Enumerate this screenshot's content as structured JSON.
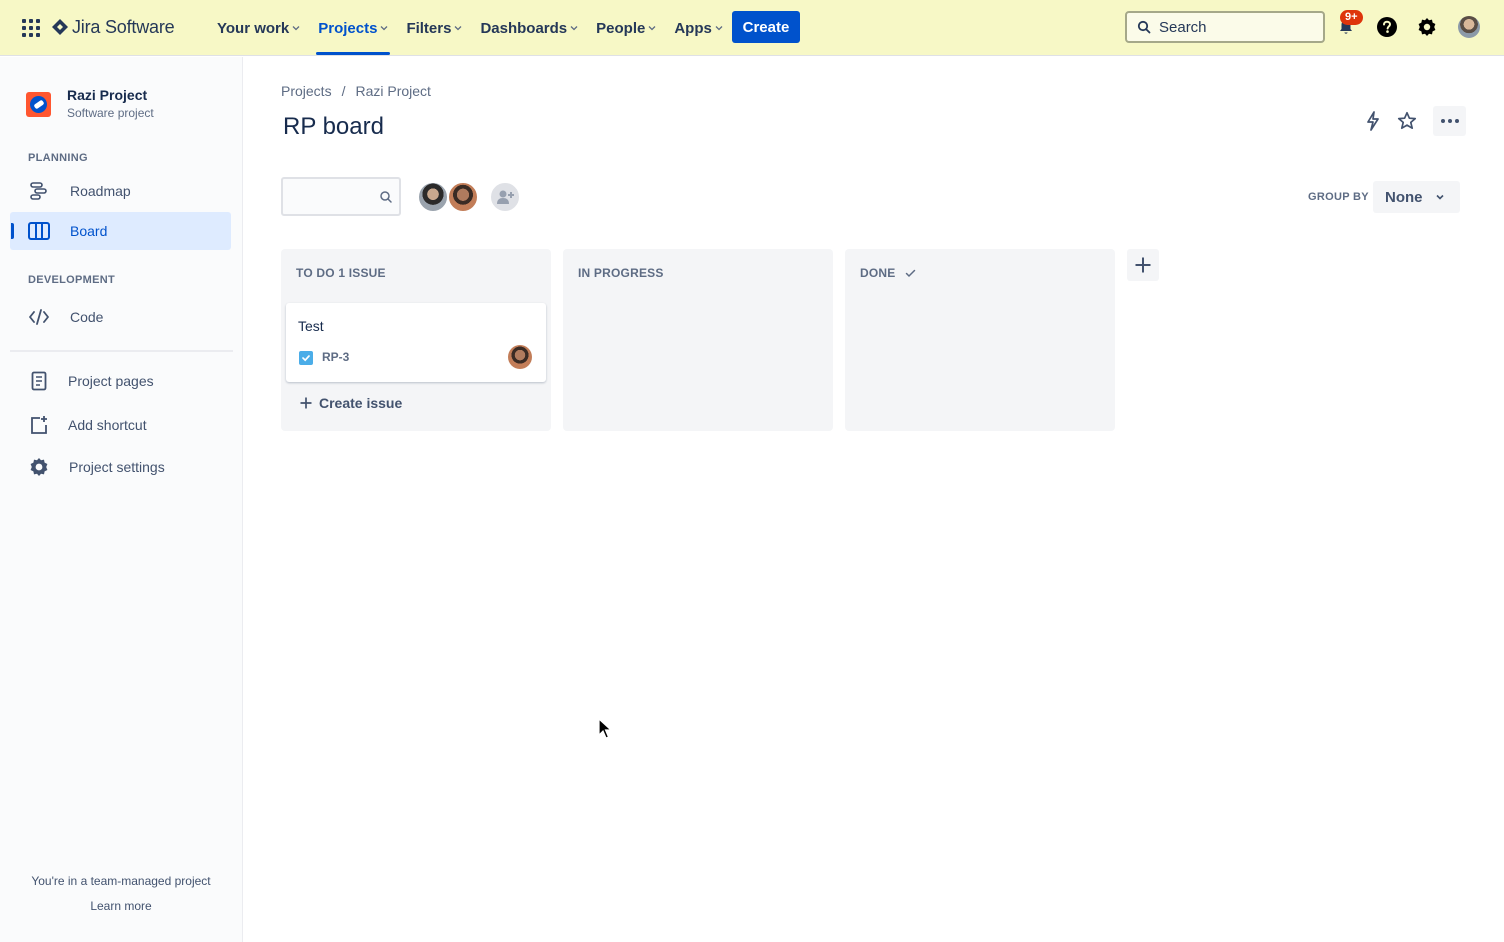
{
  "topnav": {
    "product_name": "Jira Software",
    "items": [
      {
        "label": "Your work"
      },
      {
        "label": "Projects"
      },
      {
        "label": "Filters"
      },
      {
        "label": "Dashboards"
      },
      {
        "label": "People"
      },
      {
        "label": "Apps"
      }
    ],
    "active_item": "Projects",
    "create_label": "Create",
    "search_placeholder": "Search",
    "notification_badge": "9+"
  },
  "sidebar": {
    "project_name": "Razi Project",
    "project_type": "Software project",
    "planning_label": "PLANNING",
    "development_label": "DEVELOPMENT",
    "items": {
      "roadmap": "Roadmap",
      "board": "Board",
      "code": "Code",
      "project_pages": "Project pages",
      "add_shortcut": "Add shortcut",
      "project_settings": "Project settings"
    },
    "footer_text": "You're in a team-managed project",
    "learn_more": "Learn more"
  },
  "breadcrumb": {
    "items": [
      "Projects",
      "Razi Project"
    ],
    "separator": "/"
  },
  "page": {
    "title": "RP board",
    "group_by_label": "GROUP BY",
    "group_by_value": "None"
  },
  "board": {
    "columns": [
      {
        "title": "TO DO 1 ISSUE"
      },
      {
        "title": "IN PROGRESS"
      },
      {
        "title": "DONE",
        "has_check": true
      }
    ],
    "cards": [
      {
        "title": "Test",
        "key": "RP-3",
        "type_icon": "checkbox-icon"
      }
    ],
    "create_issue_label": "Create issue"
  },
  "colors": {
    "topnav_bg": "#f7f8c6",
    "accent": "#0052cc",
    "sidebar_active_bg": "#deebff",
    "column_bg": "#f4f5f7",
    "badge": "#de350b",
    "task_icon": "#4bade8"
  }
}
